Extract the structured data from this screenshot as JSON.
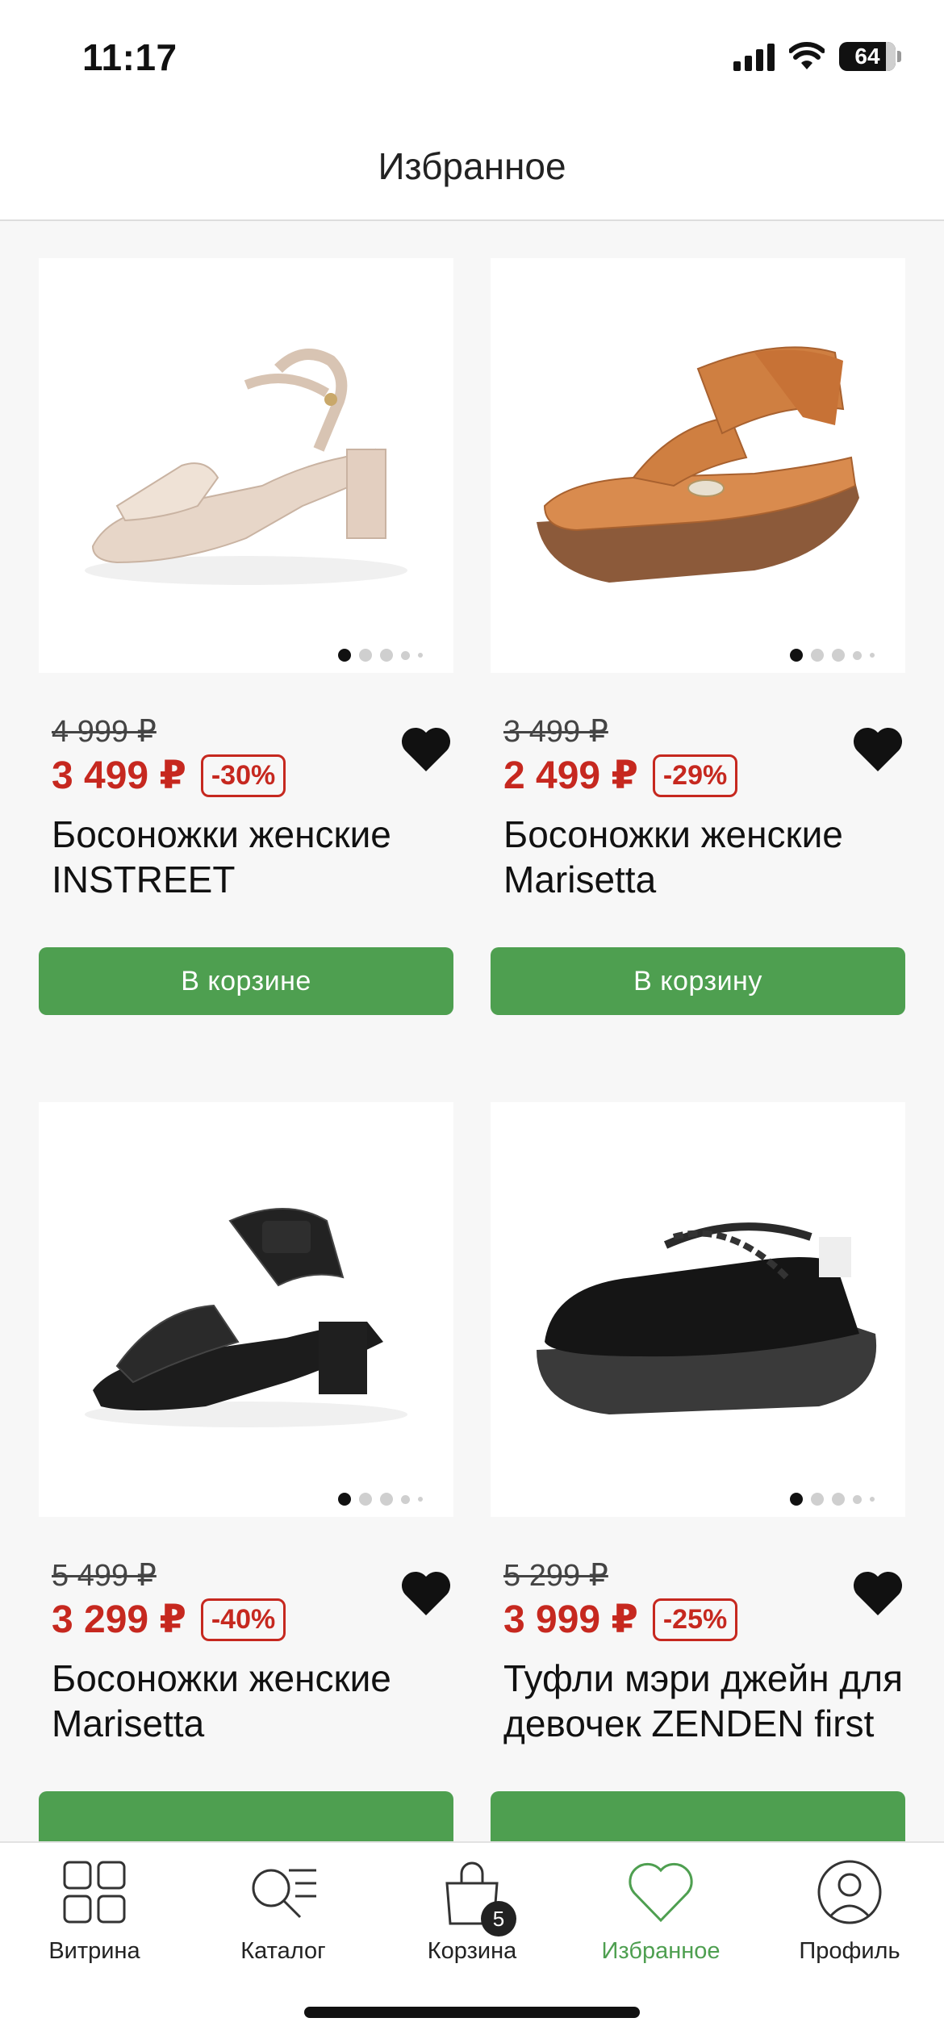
{
  "status": {
    "time": "11:17",
    "battery": "64",
    "battery_level": 0.64
  },
  "header": {
    "title": "Избранное"
  },
  "products": [
    {
      "old_price": "4 999 ₽",
      "new_price": "3 499 ₽",
      "discount": "-30%",
      "title": "Босоножки женские INSTREET",
      "button": "В корзине",
      "image": "beige-heeled-sandal",
      "favorite": true
    },
    {
      "old_price": "3 499 ₽",
      "new_price": "2 499 ₽",
      "discount": "-29%",
      "title": "Босоножки женские Marisetta",
      "button": "В корзину",
      "image": "tan-wedge-sandal",
      "favorite": true
    },
    {
      "old_price": "5 499 ₽",
      "new_price": "3 299 ₽",
      "discount": "-40%",
      "title": "Босоножки женские Marisetta",
      "button": "",
      "image": "black-heeled-sandal",
      "favorite": true
    },
    {
      "old_price": "5 299 ₽",
      "new_price": "3 999 ₽",
      "discount": "-25%",
      "title": "Туфли мэри джейн для девочек ZENDEN first",
      "button": "",
      "image": "black-mary-jane-shoe",
      "favorite": true
    }
  ],
  "tabbar": {
    "items": [
      {
        "label": "Витрина",
        "icon": "grid-icon"
      },
      {
        "label": "Каталог",
        "icon": "search-list-icon"
      },
      {
        "label": "Корзина",
        "icon": "bag-icon",
        "badge": "5"
      },
      {
        "label": "Избранное",
        "icon": "heart-outline-icon",
        "active": true
      },
      {
        "label": "Профиль",
        "icon": "profile-icon"
      }
    ]
  },
  "colors": {
    "accent_green": "#4e9f50",
    "price_red": "#c6281f"
  }
}
